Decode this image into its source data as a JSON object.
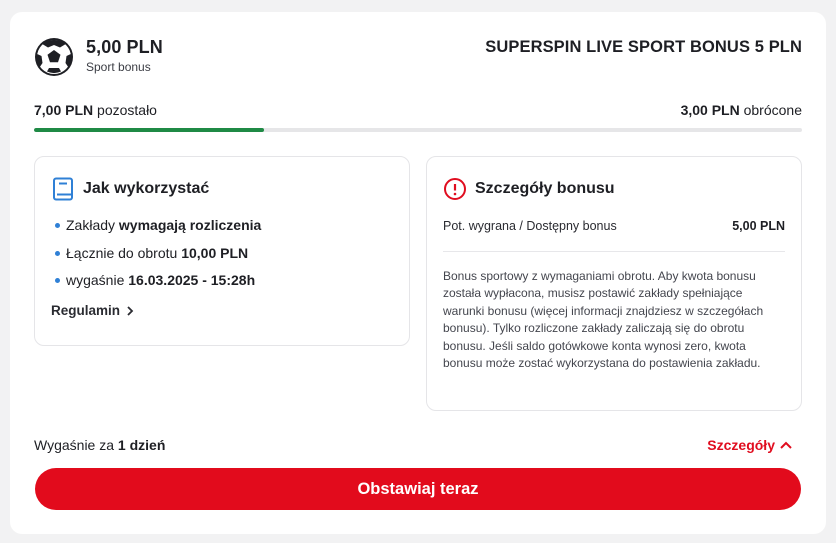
{
  "header": {
    "amount": "5,00 PLN",
    "subtitle": "Sport bonus",
    "bonus_name": "SUPERSPIN LIVE SPORT BONUS 5 PLN",
    "icon": "football-icon"
  },
  "progress": {
    "remaining_value": "7,00 PLN",
    "remaining_label": "pozostało",
    "turned_value": "3,00 PLN",
    "turned_label": "obrócone",
    "fraction": 0.3,
    "color": "#1f8a45"
  },
  "how_to_use": {
    "title": "Jak wykorzystać",
    "icon": "book-icon",
    "items": [
      {
        "text": "Zakłady ",
        "bold": "wymagają rozliczenia"
      },
      {
        "text": "Łącznie do obrotu ",
        "bold": "10,00 PLN"
      },
      {
        "text": "wygaśnie ",
        "bold": "16.03.2025 - 15:28h"
      }
    ],
    "terms_link": "Regulamin"
  },
  "details": {
    "title": "Szczegóły bonusu",
    "icon": "info-icon",
    "row_label": "Pot. wygrana / Dostępny bonus",
    "row_value": "5,00 PLN",
    "description": "Bonus sportowy z wymaganiami obrotu. Aby kwota bonusu została wypłacona, musisz postawić zakłady spełniające warunki bonusu (więcej informacji znajdziesz w szczegółach bonusu). Tylko rozliczone zakłady zaliczają się do obrotu bonusu. Jeśli saldo gotówkowe konta wynosi zero, kwota bonusu może zostać wykorzystana do postawienia zakładu."
  },
  "footer": {
    "expiry_prefix": "Wygaśnie za ",
    "expiry_value": "1 dzień",
    "details_link": "Szczegóły",
    "cta": "Obstawiaj teraz"
  },
  "colors": {
    "accent": "#e20b1c",
    "link_red": "#e00d1f",
    "info_blue": "#2f80d6"
  }
}
